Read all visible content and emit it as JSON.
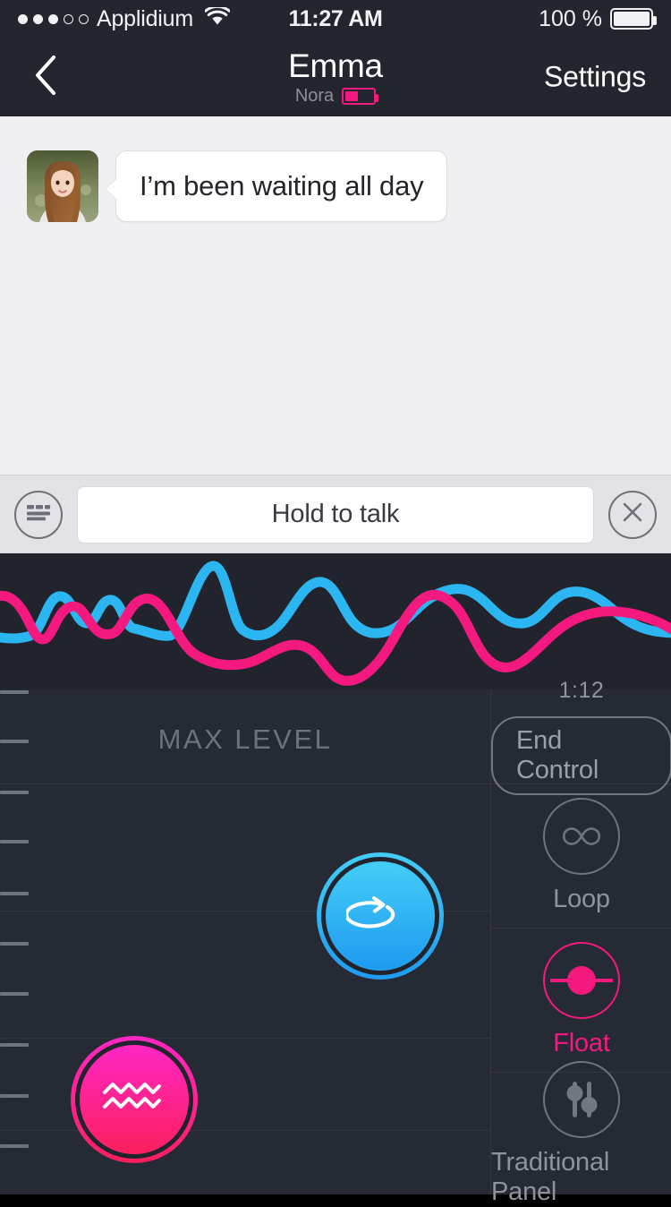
{
  "status_bar": {
    "signal_dots_filled": 3,
    "signal_dots_total": 5,
    "carrier": "Applidium",
    "wifi_icon": "wifi-icon",
    "time": "11:27 AM",
    "battery_percent": "100 %",
    "battery_level": 100
  },
  "nav_bar": {
    "back_icon": "chevron-left-icon",
    "title": "Emma",
    "device_name": "Nora",
    "device_battery_level": 42,
    "device_battery_color": "#f4197e",
    "settings_label": "Settings"
  },
  "chat": {
    "background": "#f0f0f3",
    "messages": [
      {
        "avatar": "contact-avatar",
        "text": "I’m been waiting all day",
        "side": "incoming"
      }
    ]
  },
  "input_bar": {
    "keyboard_icon": "keyboard-icon",
    "talk_label": "Hold to talk",
    "close_icon": "close-circle-icon"
  },
  "waveform": {
    "background": "#22242d",
    "series": [
      {
        "name": "blue-wave",
        "color": "#2bb6f2"
      },
      {
        "name": "pink-wave",
        "color": "#f4197e"
      }
    ]
  },
  "control_panel": {
    "max_level_label": "MAX LEVEL",
    "grid_rows": 4,
    "ticks": 9,
    "pads": [
      {
        "name": "rotate-pad",
        "icon": "rotate-arrow-icon",
        "color": "#2eb9f5",
        "color_dark": "#2196f3"
      },
      {
        "name": "wave-pad",
        "icon": "zigzag-wave-icon",
        "color": "#ff2bb0",
        "color_dark": "#fa1f66"
      }
    ]
  },
  "sidebar": {
    "timer": "1:12",
    "end_control_label": "End Control",
    "items": [
      {
        "label": "Loop",
        "icon": "infinity-icon",
        "active": false
      },
      {
        "label": "Float",
        "icon": "float-circle-icon",
        "active": true
      },
      {
        "label": "Traditional Panel",
        "icon": "sliders-icon",
        "active": false
      }
    ]
  },
  "colors": {
    "accent_pink": "#f4197e",
    "accent_blue": "#2bb6f2",
    "panel_bg": "#262a35",
    "wave_bg": "#22242d",
    "nav_bg": "#23262f"
  }
}
